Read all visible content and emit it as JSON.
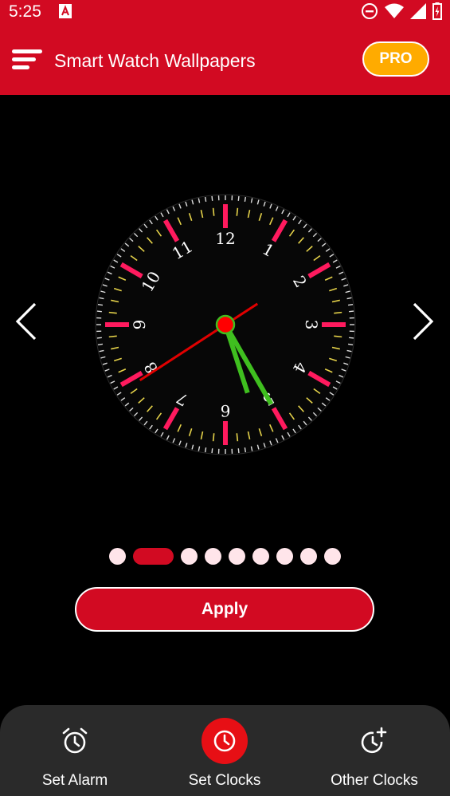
{
  "status_bar": {
    "time": "5:25",
    "icons": [
      "app-notification-icon",
      "do-not-disturb-icon",
      "wifi-icon",
      "signal-icon",
      "battery-charging-icon"
    ]
  },
  "app_bar": {
    "title": "Smart Watch Wallpapers",
    "pro_label": "PRO",
    "menu_icon": "menu-icon"
  },
  "clock": {
    "numerals": [
      "12",
      "1",
      "2",
      "3",
      "4",
      "5",
      "6",
      "7",
      "8",
      "9",
      "10",
      "11"
    ],
    "time_shown": "5:25",
    "colors": {
      "hour_marker": "#ff1a5e",
      "minute_tick": "#e6d34a",
      "hands": "#3fbf1f",
      "second_hand": "#e00000",
      "center": "#ff0000"
    }
  },
  "carousel": {
    "prev_icon": "chevron-left-icon",
    "next_icon": "chevron-right-icon",
    "page_count": 9,
    "active_page": 2
  },
  "apply_label": "Apply",
  "bottom_nav": {
    "items": [
      {
        "label": "Set Alarm",
        "icon": "alarm-clock-icon",
        "selected": false
      },
      {
        "label": "Set Clocks",
        "icon": "clock-icon",
        "selected": true
      },
      {
        "label": "Other Clocks",
        "icon": "clock-plus-icon",
        "selected": false
      }
    ]
  },
  "colors": {
    "brand_red": "#d20a22",
    "pro_orange": "#ffab00",
    "nav_bg": "#2a2a2a"
  }
}
